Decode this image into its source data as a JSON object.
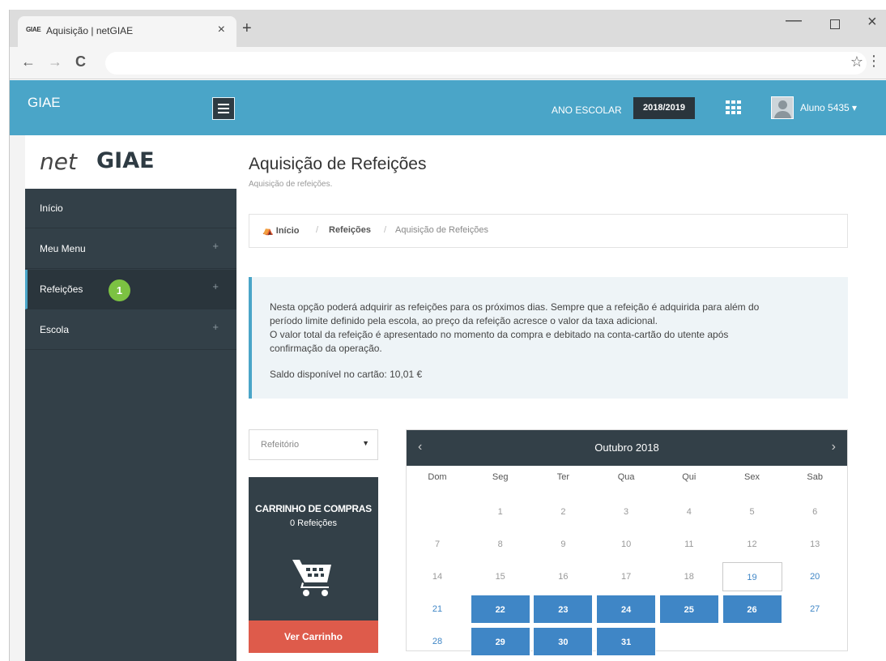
{
  "browser": {
    "tab_favicon": "GIAE",
    "tab_title": "Aquisição | netGIAE",
    "tab_close": "×",
    "new_tab": "+",
    "back": "←",
    "forward": "→",
    "reload": "C",
    "star": "☆",
    "menu": "⋮",
    "minimize": "—",
    "close": "×"
  },
  "header": {
    "brand": "GIAE",
    "ano_label": "ANO ESCOLAR",
    "ano_value": "2018/2019",
    "user": "Aluno 5435 ▾"
  },
  "sidebar": {
    "logo_net": "net",
    "logo_giae": "GIAE",
    "items": [
      {
        "label": "Início",
        "plus": ""
      },
      {
        "label": "Meu Menu",
        "plus": "+"
      },
      {
        "label": "Refeições",
        "plus": "+",
        "badge": "1"
      },
      {
        "label": "Escola",
        "plus": "+"
      }
    ]
  },
  "page": {
    "title": "Aquisição de Refeições",
    "subtitle": "Aquisição de refeições."
  },
  "breadcrumb": {
    "home": "Início",
    "sep": "/",
    "section": "Refeições",
    "current": "Aquisição de Refeições"
  },
  "info": {
    "lines": [
      "Nesta opção poderá adquirir as refeições para os próximos dias. Sempre que a refeição é adquirida para além do",
      "período limite definido pela escola, ao preço da refeição acresce o valor da taxa adicional.",
      "O valor total da refeição é apresentado no momento da compra e debitado na conta-cartão do utente após",
      "confirmação da operação."
    ],
    "saldo": "Saldo disponível no cartão:  10,01 €"
  },
  "select": {
    "value": "Refeitório",
    "caret": "▼"
  },
  "cart": {
    "title": "CARRINHO DE COMPRAS",
    "count": "0 Refeições",
    "button": "Ver Carrinho"
  },
  "calendar": {
    "prev": "‹",
    "next": "›",
    "title": "Outubro 2018",
    "weekdays": [
      "Dom",
      "Seg",
      "Ter",
      "Qua",
      "Qui",
      "Sex",
      "Sab"
    ],
    "weeks": [
      [
        "",
        "1",
        "2",
        "3",
        "4",
        "5",
        "6"
      ],
      [
        "7",
        "8",
        "9",
        "10",
        "11",
        "12",
        "13"
      ],
      [
        "14",
        "15",
        "16",
        "17",
        "18",
        "19",
        "20"
      ],
      [
        "21",
        "22",
        "23",
        "24",
        "25",
        "26",
        "27"
      ],
      [
        "28",
        "29",
        "30",
        "31",
        "",
        "",
        ""
      ]
    ],
    "selected_days": [
      "22",
      "23",
      "24",
      "25",
      "26",
      "29",
      "30",
      "31"
    ],
    "today": "19",
    "available_days": [
      "20",
      "21",
      "27",
      "28"
    ],
    "colors": {
      "header": "#334048",
      "selected": "#3f86c6"
    }
  },
  "colors": {
    "topbar": "#4aa5c8",
    "sidebar": "#334048",
    "badge": "#7cc242",
    "cart_button": "#de5b4b"
  }
}
